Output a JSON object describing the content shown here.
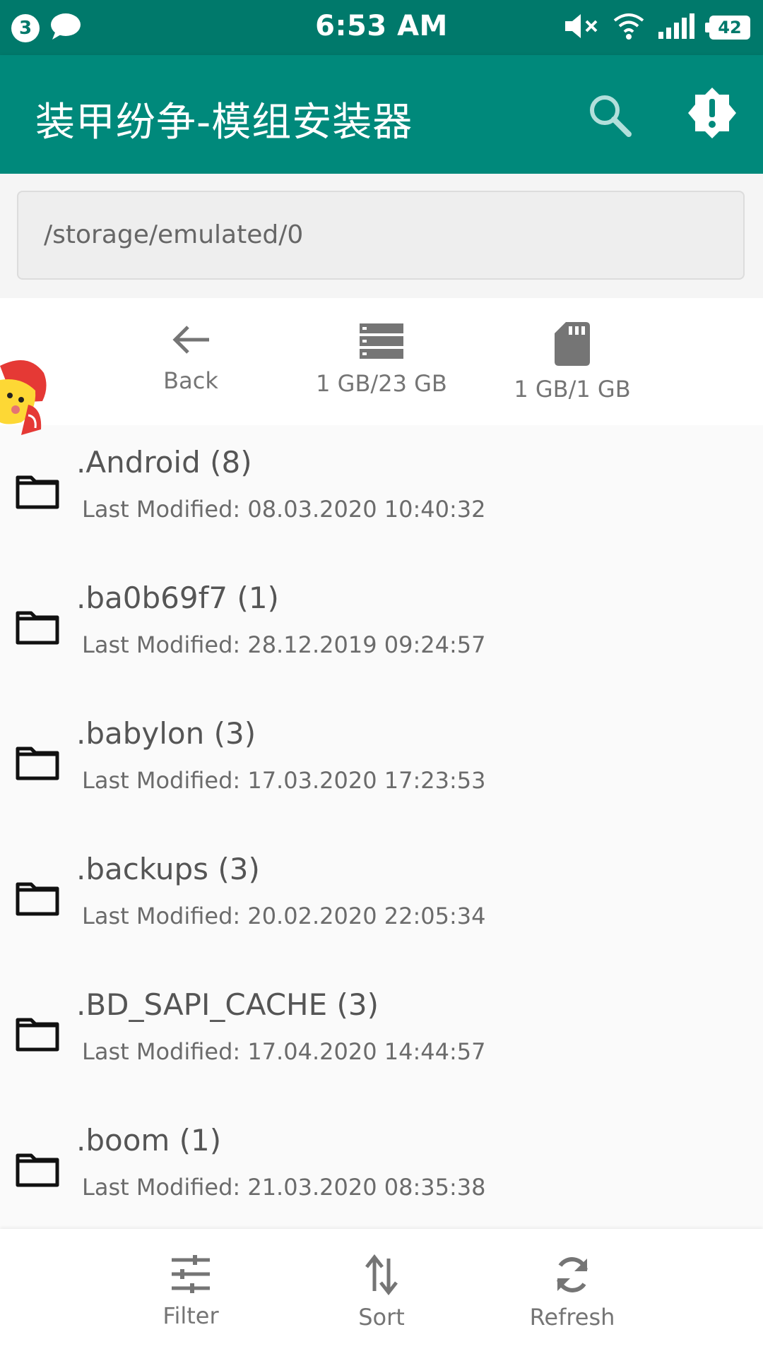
{
  "status_bar": {
    "notification_count": "3",
    "time": "6:53 AM",
    "battery": "42",
    "icons": [
      "chat-bubble-icon",
      "volume-mute-icon",
      "wifi-icon",
      "signal-icon"
    ]
  },
  "app_bar": {
    "title": "装甲纷争-模组安装器",
    "accent_color": "#00897b",
    "actions": [
      "search-icon",
      "alert-badge-icon"
    ]
  },
  "path": {
    "value": "/storage/emulated/0"
  },
  "storage": {
    "back_label": "Back",
    "internal_label": "1 GB/23 GB",
    "sd_label": "1 GB/1 GB"
  },
  "files": [
    {
      "name": ".Android (8)",
      "modified": "Last Modified: 08.03.2020 10:40:32"
    },
    {
      "name": ".ba0b69f7 (1)",
      "modified": "Last Modified: 28.12.2019 09:24:57"
    },
    {
      "name": ".babylon (3)",
      "modified": "Last Modified: 17.03.2020 17:23:53"
    },
    {
      "name": ".backups (3)",
      "modified": "Last Modified: 20.02.2020 22:05:34"
    },
    {
      "name": ".BD_SAPI_CACHE (3)",
      "modified": "Last Modified: 17.04.2020 14:44:57"
    },
    {
      "name": ".boom (1)",
      "modified": "Last Modified: 21.03.2020 08:35:38"
    }
  ],
  "bottom_bar": {
    "filter_label": "Filter",
    "sort_label": "Sort",
    "refresh_label": "Refresh"
  }
}
